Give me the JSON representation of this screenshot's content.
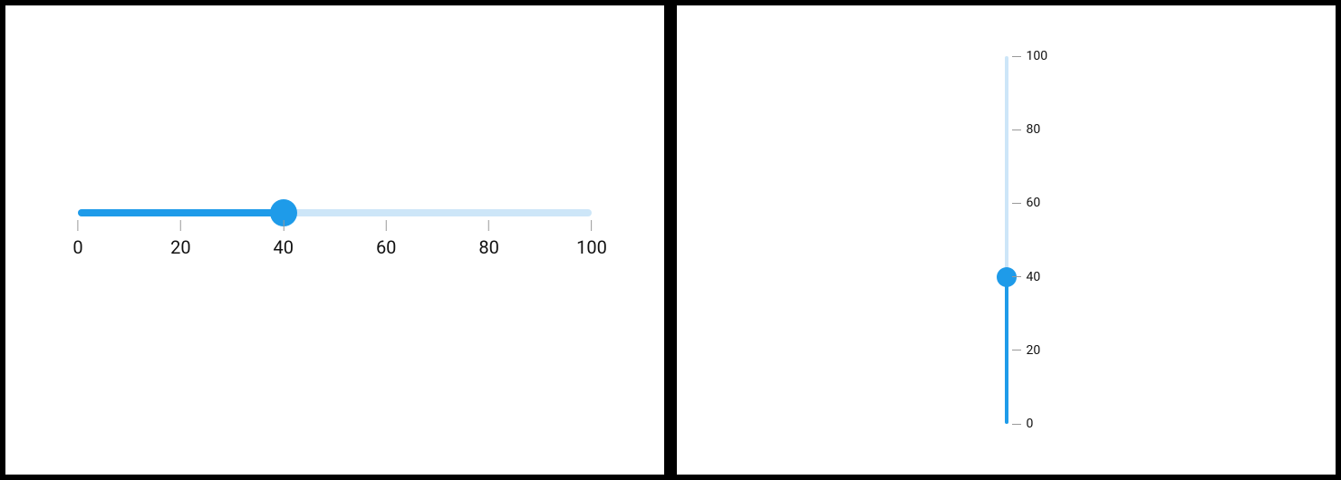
{
  "horizontal_slider": {
    "min": 0,
    "max": 100,
    "value": 40,
    "ticks": [
      0,
      20,
      40,
      60,
      80,
      100
    ]
  },
  "vertical_slider": {
    "min": 0,
    "max": 100,
    "value": 40,
    "ticks": [
      0,
      20,
      40,
      60,
      80,
      100
    ]
  },
  "colors": {
    "track_inactive": "#cde6f8",
    "track_active": "#1e9be9",
    "thumb": "#1e9be9"
  }
}
